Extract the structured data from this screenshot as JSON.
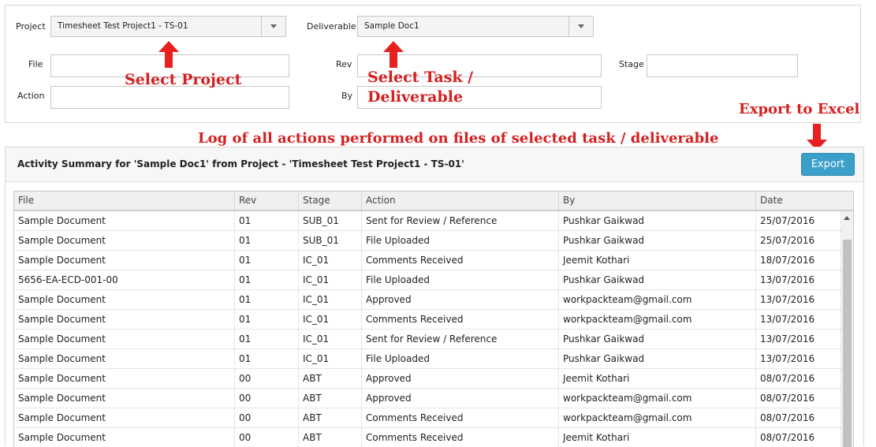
{
  "filters": {
    "project_label": "Project",
    "project_value": "Timesheet Test Project1 - TS-01",
    "deliverable_label": "Deliverable",
    "deliverable_value": "Sample Doc1",
    "file_label": "File",
    "rev_label": "Rev",
    "stage_label": "Stage",
    "action_label": "Action",
    "by_label": "By"
  },
  "annotations": {
    "select_project": "Select Project",
    "select_task_line1": "Select Task /",
    "select_task_line2": "Deliverable",
    "export_to_excel": "Export to Excel",
    "log_note": "Log of all actions performed on files of selected task / deliverable",
    "color": "#d42020"
  },
  "summary": {
    "title": "Activity Summary for 'Sample Doc1' from Project - 'Timesheet Test Project1 - TS-01'",
    "export_label": "Export",
    "accent": "#3a9fc9"
  },
  "table": {
    "columns": [
      "File",
      "Rev",
      "Stage",
      "Action",
      "By",
      "Date"
    ],
    "rows": [
      [
        "Sample Document",
        "01",
        "SUB_01",
        "Sent for Review / Reference",
        "Pushkar Gaikwad",
        "25/07/2016"
      ],
      [
        "Sample Document",
        "01",
        "SUB_01",
        "File Uploaded",
        "Pushkar Gaikwad",
        "25/07/2016"
      ],
      [
        "Sample Document",
        "01",
        "IC_01",
        "Comments Received",
        "Jeemit Kothari",
        "18/07/2016"
      ],
      [
        "5656-EA-ECD-001-00",
        "01",
        "IC_01",
        "File Uploaded",
        "Pushkar Gaikwad",
        "13/07/2016"
      ],
      [
        "Sample Document",
        "01",
        "IC_01",
        "Approved",
        "workpackteam@gmail.com",
        "13/07/2016"
      ],
      [
        "Sample Document",
        "01",
        "IC_01",
        "Comments Received",
        "workpackteam@gmail.com",
        "13/07/2016"
      ],
      [
        "Sample Document",
        "01",
        "IC_01",
        "Sent for Review / Reference",
        "Pushkar Gaikwad",
        "13/07/2016"
      ],
      [
        "Sample Document",
        "01",
        "IC_01",
        "File Uploaded",
        "Pushkar Gaikwad",
        "13/07/2016"
      ],
      [
        "Sample Document",
        "00",
        "ABT",
        "Approved",
        "Jeemit Kothari",
        "08/07/2016"
      ],
      [
        "Sample Document",
        "00",
        "ABT",
        "Approved",
        "workpackteam@gmail.com",
        "08/07/2016"
      ],
      [
        "Sample Document",
        "00",
        "ABT",
        "Comments Received",
        "workpackteam@gmail.com",
        "08/07/2016"
      ],
      [
        "Sample Document",
        "00",
        "ABT",
        "Comments Received",
        "Jeemit Kothari",
        "08/07/2016"
      ]
    ]
  }
}
